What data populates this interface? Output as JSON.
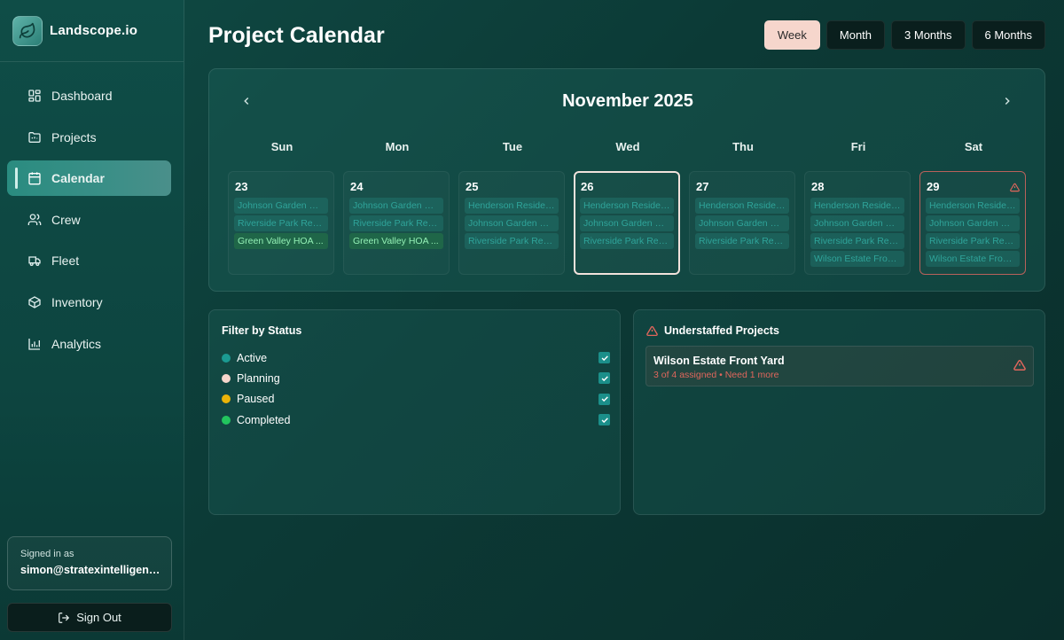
{
  "app": {
    "name": "Landscope.io",
    "logo_icon": "leaf-icon"
  },
  "sidebar": {
    "items": [
      {
        "label": "Dashboard",
        "icon": "dashboard-grid-icon"
      },
      {
        "label": "Projects",
        "icon": "folder-icon"
      },
      {
        "label": "Calendar",
        "icon": "calendar-icon",
        "active": true
      },
      {
        "label": "Crew",
        "icon": "users-icon"
      },
      {
        "label": "Fleet",
        "icon": "truck-icon"
      },
      {
        "label": "Inventory",
        "icon": "box-icon"
      },
      {
        "label": "Analytics",
        "icon": "bar-chart-icon"
      }
    ],
    "signed_in_label": "Signed in as",
    "signed_in_email": "simon@stratexintelligenc...",
    "sign_out_label": "Sign Out"
  },
  "header": {
    "title": "Project Calendar",
    "ranges": [
      "Week",
      "Month",
      "3 Months",
      "6 Months"
    ],
    "selected_range": "Week"
  },
  "calendar": {
    "month_label": "November 2025",
    "weekdays": [
      "Sun",
      "Mon",
      "Tue",
      "Wed",
      "Thu",
      "Fri",
      "Sat"
    ],
    "days": [
      {
        "num": "23",
        "events": [
          {
            "label": "Johnson Garden Re...",
            "status": "active"
          },
          {
            "label": "Riverside Park Ren...",
            "status": "active"
          },
          {
            "label": "Green Valley HOA ...",
            "status": "completed"
          }
        ]
      },
      {
        "num": "24",
        "events": [
          {
            "label": "Johnson Garden Re...",
            "status": "active"
          },
          {
            "label": "Riverside Park Ren...",
            "status": "active"
          },
          {
            "label": "Green Valley HOA ...",
            "status": "completed"
          }
        ]
      },
      {
        "num": "25",
        "events": [
          {
            "label": "Henderson Residen...",
            "status": "active"
          },
          {
            "label": "Johnson Garden Re...",
            "status": "active"
          },
          {
            "label": "Riverside Park Ren...",
            "status": "active"
          }
        ]
      },
      {
        "num": "26",
        "today": true,
        "events": [
          {
            "label": "Henderson Residen...",
            "status": "active"
          },
          {
            "label": "Johnson Garden Re...",
            "status": "active"
          },
          {
            "label": "Riverside Park Ren...",
            "status": "active"
          }
        ]
      },
      {
        "num": "27",
        "events": [
          {
            "label": "Henderson Residen...",
            "status": "active"
          },
          {
            "label": "Johnson Garden Re...",
            "status": "active"
          },
          {
            "label": "Riverside Park Ren...",
            "status": "active"
          }
        ]
      },
      {
        "num": "28",
        "events": [
          {
            "label": "Henderson Residen...",
            "status": "active"
          },
          {
            "label": "Johnson Garden Re...",
            "status": "active"
          },
          {
            "label": "Riverside Park Ren...",
            "status": "active"
          },
          {
            "label": "Wilson Estate Front...",
            "status": "active"
          }
        ]
      },
      {
        "num": "29",
        "alert": true,
        "events": [
          {
            "label": "Henderson Residen...",
            "status": "active"
          },
          {
            "label": "Johnson Garden Re...",
            "status": "active"
          },
          {
            "label": "Riverside Park Ren...",
            "status": "active"
          },
          {
            "label": "Wilson Estate Front...",
            "status": "active"
          }
        ]
      }
    ]
  },
  "filter": {
    "title": "Filter by Status",
    "statuses": [
      {
        "label": "Active",
        "color": "#1b9a92",
        "checked": true
      },
      {
        "label": "Planning",
        "color": "#f6d6cc",
        "checked": true
      },
      {
        "label": "Paused",
        "color": "#eab308",
        "checked": true
      },
      {
        "label": "Completed",
        "color": "#22c55e",
        "checked": true
      }
    ]
  },
  "understaffed": {
    "title": "Understaffed Projects",
    "items": [
      {
        "name": "Wilson Estate Front Yard",
        "detail": "3 of 4 assigned • Need 1 more"
      }
    ]
  },
  "colors": {
    "accent": "#1b8f8a",
    "selected_range_bg": "#f6d6cc",
    "warning": "#e0665c"
  }
}
